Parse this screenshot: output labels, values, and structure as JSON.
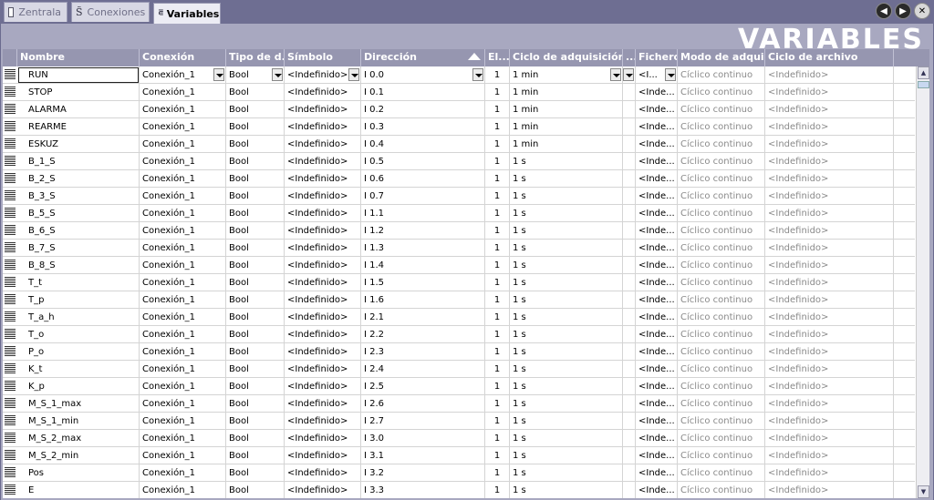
{
  "tabs": [
    {
      "label": "Zentrala"
    },
    {
      "label": "Conexiones"
    },
    {
      "label": "Variables"
    }
  ],
  "nav": {
    "back": "◀",
    "forward": "▶",
    "close": "✕"
  },
  "watermark": "VARIABLES",
  "columns": {
    "nombre": "Nombre",
    "conexion": "Conexión",
    "tipo": "Tipo de d...",
    "simbolo": "Símbolo",
    "direccion": "Dirección",
    "el": "El...",
    "ciclo": "Ciclo de adquisición",
    "dots": "...",
    "fichero": "Fichero",
    "modo": "Modo de adqui...",
    "archivo": "Ciclo de archivo"
  },
  "rows": [
    {
      "nombre": "RUN",
      "conexion": "Conexión_1",
      "tipo": "Bool",
      "simbolo": "<Indefinido>",
      "direccion": "I 0.0",
      "el": "1",
      "ciclo": "1 min",
      "fichero": "<I...",
      "modo": "Cíclico continuo",
      "archivo": "<Indefinido>"
    },
    {
      "nombre": "STOP",
      "conexion": "Conexión_1",
      "tipo": "Bool",
      "simbolo": "<Indefinido>",
      "direccion": "I 0.1",
      "el": "1",
      "ciclo": "1 min",
      "fichero": "<Inde...",
      "modo": "Cíclico continuo",
      "archivo": "<Indefinido>"
    },
    {
      "nombre": "ALARMA",
      "conexion": "Conexión_1",
      "tipo": "Bool",
      "simbolo": "<Indefinido>",
      "direccion": "I 0.2",
      "el": "1",
      "ciclo": "1 min",
      "fichero": "<Inde...",
      "modo": "Cíclico continuo",
      "archivo": "<Indefinido>"
    },
    {
      "nombre": "REARME",
      "conexion": "Conexión_1",
      "tipo": "Bool",
      "simbolo": "<Indefinido>",
      "direccion": "I 0.3",
      "el": "1",
      "ciclo": "1 min",
      "fichero": "<Inde...",
      "modo": "Cíclico continuo",
      "archivo": "<Indefinido>"
    },
    {
      "nombre": "ESKUZ",
      "conexion": "Conexión_1",
      "tipo": "Bool",
      "simbolo": "<Indefinido>",
      "direccion": "I 0.4",
      "el": "1",
      "ciclo": "1 min",
      "fichero": "<Inde...",
      "modo": "Cíclico continuo",
      "archivo": "<Indefinido>"
    },
    {
      "nombre": "B_1_S",
      "conexion": "Conexión_1",
      "tipo": "Bool",
      "simbolo": "<Indefinido>",
      "direccion": "I 0.5",
      "el": "1",
      "ciclo": "1 s",
      "fichero": "<Inde...",
      "modo": "Cíclico continuo",
      "archivo": "<Indefinido>"
    },
    {
      "nombre": "B_2_S",
      "conexion": "Conexión_1",
      "tipo": "Bool",
      "simbolo": "<Indefinido>",
      "direccion": "I 0.6",
      "el": "1",
      "ciclo": "1 s",
      "fichero": "<Inde...",
      "modo": "Cíclico continuo",
      "archivo": "<Indefinido>"
    },
    {
      "nombre": "B_3_S",
      "conexion": "Conexión_1",
      "tipo": "Bool",
      "simbolo": "<Indefinido>",
      "direccion": "I 0.7",
      "el": "1",
      "ciclo": "1 s",
      "fichero": "<Inde...",
      "modo": "Cíclico continuo",
      "archivo": "<Indefinido>"
    },
    {
      "nombre": "B_5_S",
      "conexion": "Conexión_1",
      "tipo": "Bool",
      "simbolo": "<Indefinido>",
      "direccion": "I 1.1",
      "el": "1",
      "ciclo": "1 s",
      "fichero": "<Inde...",
      "modo": "Cíclico continuo",
      "archivo": "<Indefinido>"
    },
    {
      "nombre": "B_6_S",
      "conexion": "Conexión_1",
      "tipo": "Bool",
      "simbolo": "<Indefinido>",
      "direccion": "I 1.2",
      "el": "1",
      "ciclo": "1 s",
      "fichero": "<Inde...",
      "modo": "Cíclico continuo",
      "archivo": "<Indefinido>"
    },
    {
      "nombre": "B_7_S",
      "conexion": "Conexión_1",
      "tipo": "Bool",
      "simbolo": "<Indefinido>",
      "direccion": "I 1.3",
      "el": "1",
      "ciclo": "1 s",
      "fichero": "<Inde...",
      "modo": "Cíclico continuo",
      "archivo": "<Indefinido>"
    },
    {
      "nombre": "B_8_S",
      "conexion": "Conexión_1",
      "tipo": "Bool",
      "simbolo": "<Indefinido>",
      "direccion": "I 1.4",
      "el": "1",
      "ciclo": "1 s",
      "fichero": "<Inde...",
      "modo": "Cíclico continuo",
      "archivo": "<Indefinido>"
    },
    {
      "nombre": "T_t",
      "conexion": "Conexión_1",
      "tipo": "Bool",
      "simbolo": "<Indefinido>",
      "direccion": "I 1.5",
      "el": "1",
      "ciclo": "1 s",
      "fichero": "<Inde...",
      "modo": "Cíclico continuo",
      "archivo": "<Indefinido>"
    },
    {
      "nombre": "T_p",
      "conexion": "Conexión_1",
      "tipo": "Bool",
      "simbolo": "<Indefinido>",
      "direccion": "I 1.6",
      "el": "1",
      "ciclo": "1 s",
      "fichero": "<Inde...",
      "modo": "Cíclico continuo",
      "archivo": "<Indefinido>"
    },
    {
      "nombre": "T_a_h",
      "conexion": "Conexión_1",
      "tipo": "Bool",
      "simbolo": "<Indefinido>",
      "direccion": "I 2.1",
      "el": "1",
      "ciclo": "1 s",
      "fichero": "<Inde...",
      "modo": "Cíclico continuo",
      "archivo": "<Indefinido>"
    },
    {
      "nombre": "T_o",
      "conexion": "Conexión_1",
      "tipo": "Bool",
      "simbolo": "<Indefinido>",
      "direccion": "I 2.2",
      "el": "1",
      "ciclo": "1 s",
      "fichero": "<Inde...",
      "modo": "Cíclico continuo",
      "archivo": "<Indefinido>"
    },
    {
      "nombre": "P_o",
      "conexion": "Conexión_1",
      "tipo": "Bool",
      "simbolo": "<Indefinido>",
      "direccion": "I 2.3",
      "el": "1",
      "ciclo": "1 s",
      "fichero": "<Inde...",
      "modo": "Cíclico continuo",
      "archivo": "<Indefinido>"
    },
    {
      "nombre": "K_t",
      "conexion": "Conexión_1",
      "tipo": "Bool",
      "simbolo": "<Indefinido>",
      "direccion": "I 2.4",
      "el": "1",
      "ciclo": "1 s",
      "fichero": "<Inde...",
      "modo": "Cíclico continuo",
      "archivo": "<Indefinido>"
    },
    {
      "nombre": "K_p",
      "conexion": "Conexión_1",
      "tipo": "Bool",
      "simbolo": "<Indefinido>",
      "direccion": "I 2.5",
      "el": "1",
      "ciclo": "1 s",
      "fichero": "<Inde...",
      "modo": "Cíclico continuo",
      "archivo": "<Indefinido>"
    },
    {
      "nombre": "M_S_1_max",
      "conexion": "Conexión_1",
      "tipo": "Bool",
      "simbolo": "<Indefinido>",
      "direccion": "I 2.6",
      "el": "1",
      "ciclo": "1 s",
      "fichero": "<Inde...",
      "modo": "Cíclico continuo",
      "archivo": "<Indefinido>"
    },
    {
      "nombre": "M_S_1_min",
      "conexion": "Conexión_1",
      "tipo": "Bool",
      "simbolo": "<Indefinido>",
      "direccion": "I 2.7",
      "el": "1",
      "ciclo": "1 s",
      "fichero": "<Inde...",
      "modo": "Cíclico continuo",
      "archivo": "<Indefinido>"
    },
    {
      "nombre": "M_S_2_max",
      "conexion": "Conexión_1",
      "tipo": "Bool",
      "simbolo": "<Indefinido>",
      "direccion": "I 3.0",
      "el": "1",
      "ciclo": "1 s",
      "fichero": "<Inde...",
      "modo": "Cíclico continuo",
      "archivo": "<Indefinido>"
    },
    {
      "nombre": "M_S_2_min",
      "conexion": "Conexión_1",
      "tipo": "Bool",
      "simbolo": "<Indefinido>",
      "direccion": "I 3.1",
      "el": "1",
      "ciclo": "1 s",
      "fichero": "<Inde...",
      "modo": "Cíclico continuo",
      "archivo": "<Indefinido>"
    },
    {
      "nombre": "Pos",
      "conexion": "Conexión_1",
      "tipo": "Bool",
      "simbolo": "<Indefinido>",
      "direccion": "I 3.2",
      "el": "1",
      "ciclo": "1 s",
      "fichero": "<Inde...",
      "modo": "Cíclico continuo",
      "archivo": "<Indefinido>"
    },
    {
      "nombre": "E",
      "conexion": "Conexión_1",
      "tipo": "Bool",
      "simbolo": "<Indefinido>",
      "direccion": "I 3.3",
      "el": "1",
      "ciclo": "1 s",
      "fichero": "<Inde...",
      "modo": "Cíclico continuo",
      "archivo": "<Indefinido>"
    }
  ]
}
